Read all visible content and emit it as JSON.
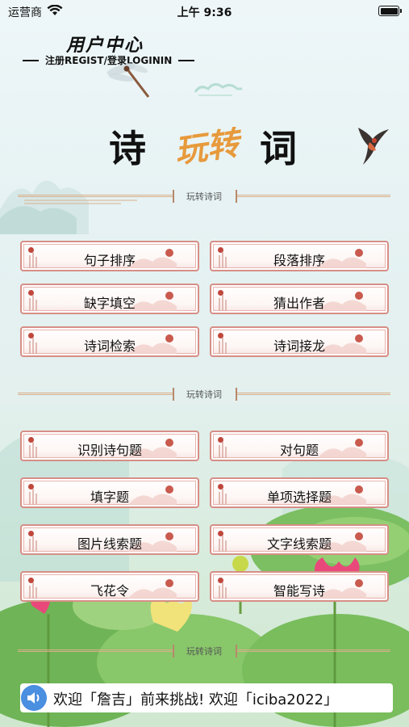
{
  "status_bar": {
    "carrier": "运营商",
    "time": "上午 9:36"
  },
  "header": {
    "title": "用户中心",
    "login_text": "注册REGIST/登录LOGININ"
  },
  "logo": {
    "left": "诗",
    "middle": "玩转",
    "right": "词"
  },
  "section_label": "玩转诗词",
  "section1_buttons": [
    {
      "label": "句子排序"
    },
    {
      "label": "段落排序"
    },
    {
      "label": "缺字填空"
    },
    {
      "label": "猜出作者"
    },
    {
      "label": "诗词检索"
    },
    {
      "label": "诗词接龙"
    }
  ],
  "section2_buttons": [
    {
      "label": "识别诗句题"
    },
    {
      "label": "对句题"
    },
    {
      "label": "填字题"
    },
    {
      "label": "单项选择题"
    },
    {
      "label": "图片线索题"
    },
    {
      "label": "文字线索题"
    },
    {
      "label": "飞花令"
    },
    {
      "label": "智能写诗"
    }
  ],
  "announcement": "欢迎「詹吉」前来挑战!     欢迎「iciba2022」",
  "icons": [
    "wifi-icon",
    "battery-icon",
    "dragonfly-icon",
    "cloud-icon",
    "swallow-icon",
    "speaker-icon"
  ],
  "colors": {
    "button_border": "#d78e86",
    "accent_orange": "#e79a3c",
    "speaker_blue": "#4a8fe0"
  }
}
